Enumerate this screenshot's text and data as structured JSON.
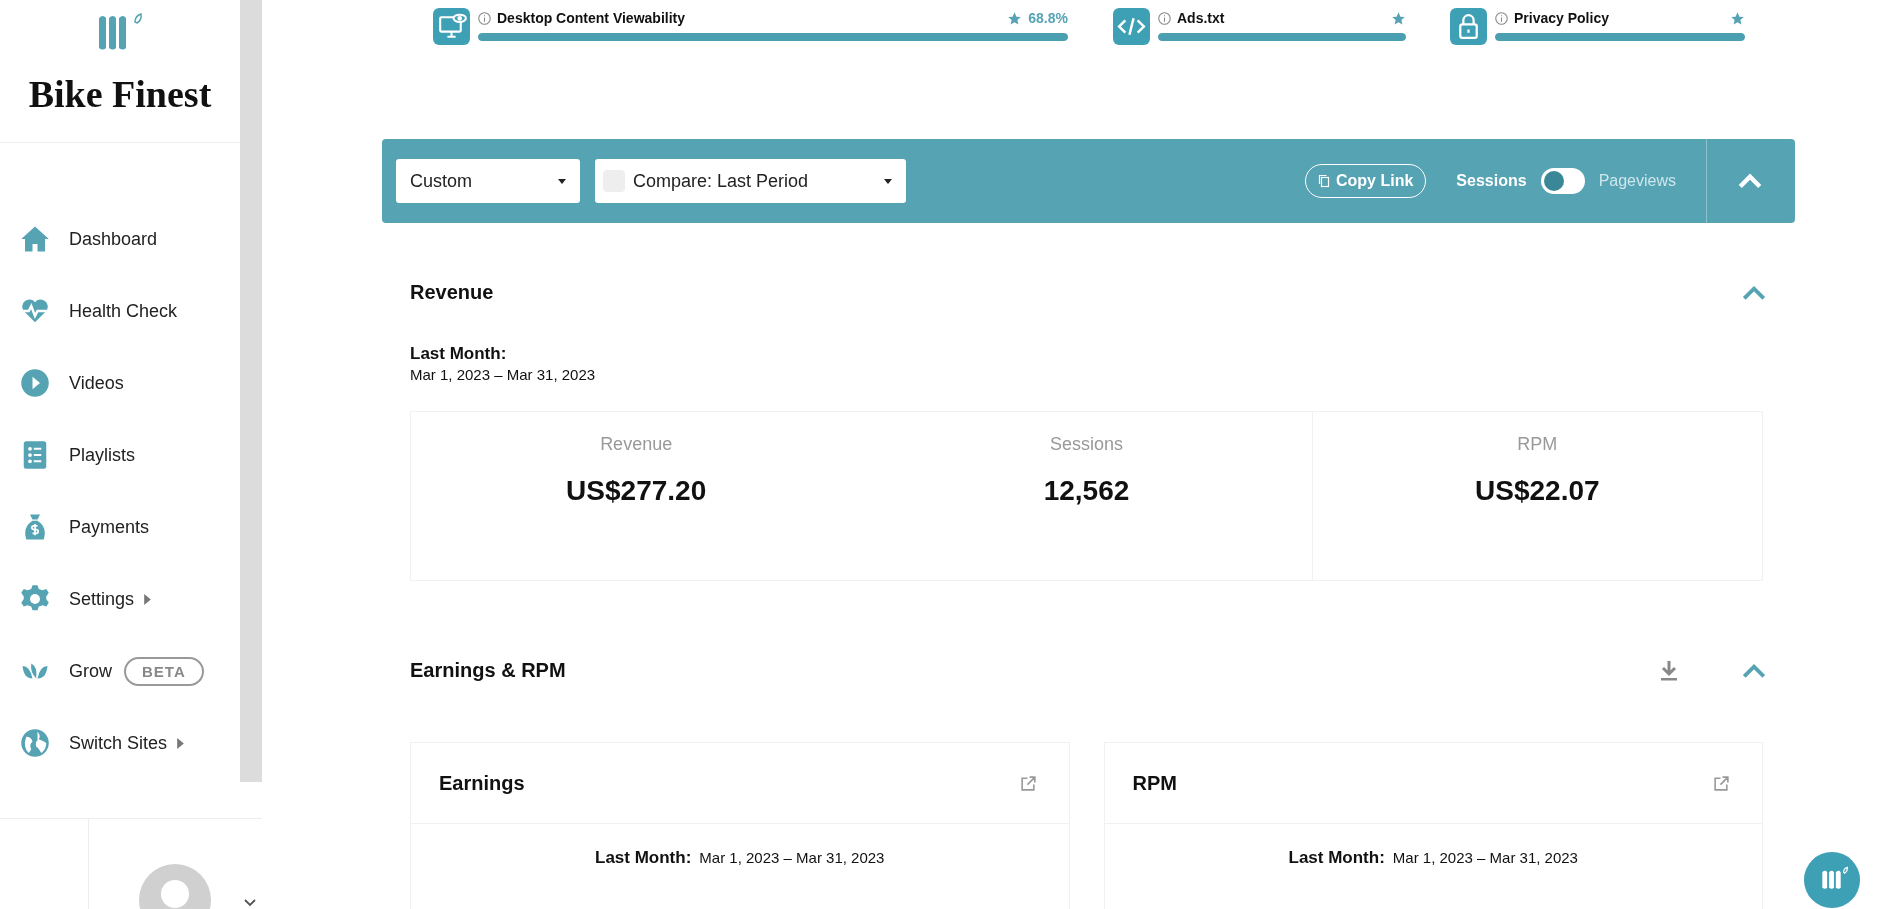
{
  "brand": {
    "name": "Bike Finest"
  },
  "sidebar": {
    "items": [
      {
        "label": "Dashboard",
        "has_submenu": false
      },
      {
        "label": "Health Check",
        "has_submenu": false
      },
      {
        "label": "Videos",
        "has_submenu": false
      },
      {
        "label": "Playlists",
        "has_submenu": false
      },
      {
        "label": "Payments",
        "has_submenu": false
      },
      {
        "label": "Settings",
        "has_submenu": true
      },
      {
        "label": "Grow",
        "has_submenu": false,
        "badge": "BETA"
      },
      {
        "label": "Switch Sites",
        "has_submenu": true
      }
    ]
  },
  "health_metrics": [
    {
      "label": "Desktop Content Viewability",
      "level": 1,
      "reading": "68.8%"
    },
    {
      "label": "Ads.txt",
      "level": 1
    },
    {
      "label": "Privacy Policy",
      "level": 1
    }
  ],
  "toolbar": {
    "range": "Custom",
    "compare": {
      "label": "Compare: Last Period",
      "checked": false
    },
    "copy_link": "Copy Link",
    "toggle": {
      "left": "Sessions",
      "right": "Pageviews",
      "on": false
    }
  },
  "revenue": {
    "title": "Revenue",
    "period_label": "Last Month:",
    "period": "Mar 1, 2023 – Mar 31, 2023",
    "stats": [
      {
        "label": "Revenue",
        "value": "US$277.20"
      },
      {
        "label": "Sessions",
        "value": "12,562"
      },
      {
        "label": "RPM",
        "value": "US$22.07"
      }
    ]
  },
  "earnings_rpm": {
    "title": "Earnings & RPM",
    "cards": [
      {
        "title": "Earnings",
        "period_label": "Last Month:",
        "period": "Mar 1, 2023 – Mar 31, 2023"
      },
      {
        "title": "RPM",
        "period_label": "Last Month:",
        "period": "Mar 1, 2023 – Mar 31, 2023"
      }
    ]
  }
}
